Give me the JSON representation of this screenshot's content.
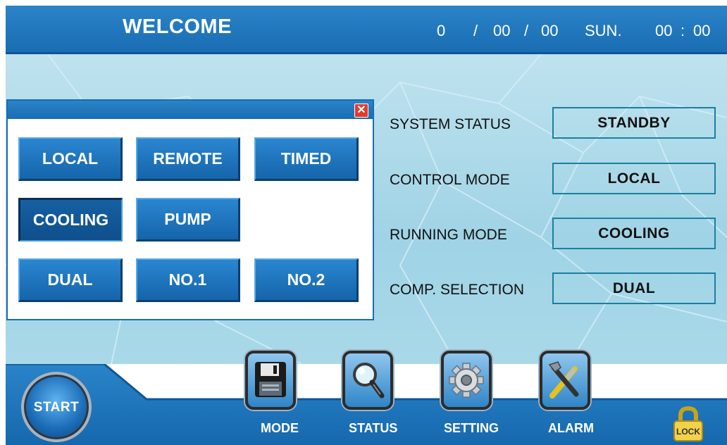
{
  "header": {
    "title": "WELCOME",
    "date_year": "0",
    "date_sep1": "/",
    "date_month": "00",
    "date_sep2": "/",
    "date_day": "00",
    "weekday": "SUN.",
    "time_hour": "00",
    "time_sep": ":",
    "time_minute": "00"
  },
  "dialog": {
    "close_symbol": "✕",
    "buttons": [
      {
        "label": "LOCAL"
      },
      {
        "label": "REMOTE"
      },
      {
        "label": "TIMED"
      },
      {
        "label": "COOLING"
      },
      {
        "label": "PUMP"
      },
      {
        "label": "DUAL"
      },
      {
        "label": "NO.1"
      },
      {
        "label": "NO.2"
      }
    ]
  },
  "status": [
    {
      "label": "SYSTEM STATUS",
      "value": "STANDBY"
    },
    {
      "label": "CONTROL MODE",
      "value": "LOCAL"
    },
    {
      "label": "RUNNING MODE",
      "value": "COOLING"
    },
    {
      "label": "COMP. SELECTION",
      "value": "DUAL"
    }
  ],
  "nav": {
    "start": "START",
    "mode": "MODE",
    "status": "STATUS",
    "setting": "SETTING",
    "alarm": "ALARM",
    "lock": "LOCK"
  },
  "icons": {
    "mode": "floppy-disk-icon",
    "status": "magnifier-icon",
    "setting": "gear-icon",
    "alarm": "tools-icon",
    "lock": "padlock-icon",
    "close": "close-icon"
  },
  "colors": {
    "header": "#1a6db2",
    "background": "#a9d9e9",
    "button": "#1a6db2",
    "close": "#e23b2e",
    "status_border": "#1b7fa0"
  }
}
